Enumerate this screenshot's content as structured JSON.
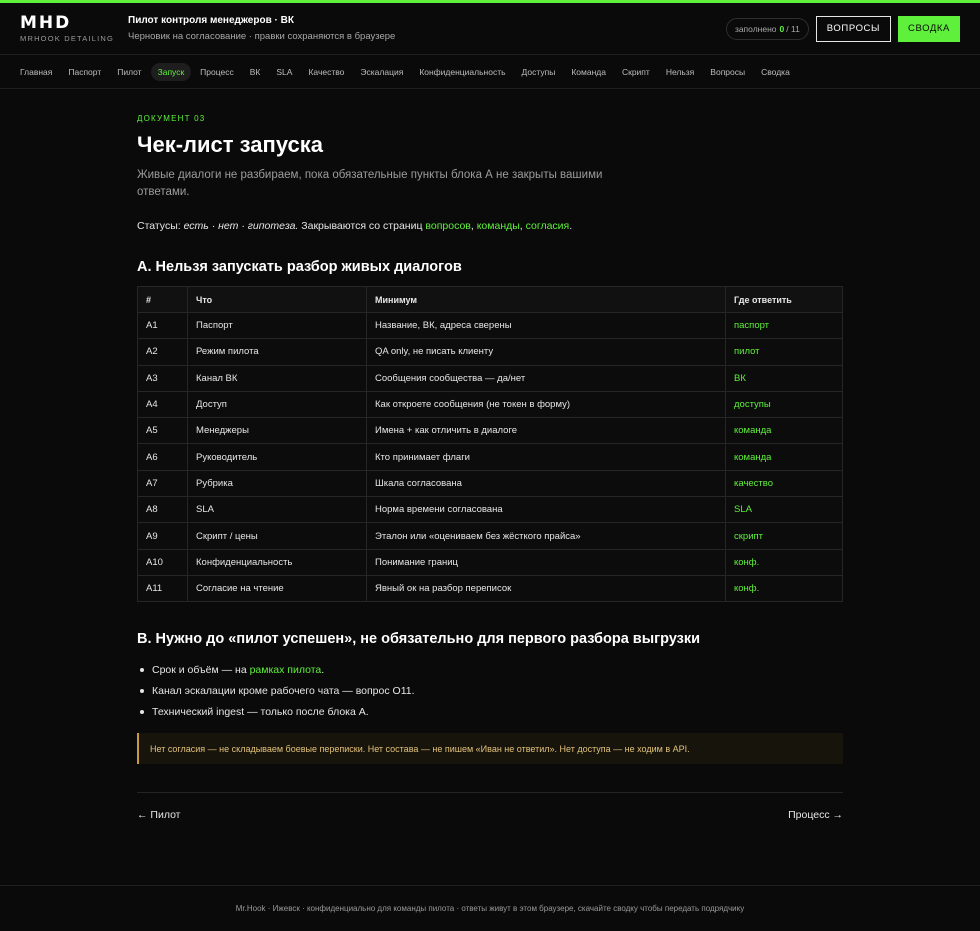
{
  "header": {
    "logo": "MHD",
    "logo_sub": "MRHOOK DETAILING",
    "title": "Пилот контроля менеджеров · ВК",
    "subtitle": "Черновик на согласование · правки сохраняются в браузере",
    "counter_prefix": "заполнено",
    "counter_filled": "0",
    "counter_total": "/ 11",
    "questions_button": "ВОПРОСЫ",
    "summary_button": "СВОДКА"
  },
  "nav": {
    "tabs": [
      "Главная",
      "Паспорт",
      "Пилот",
      "Запуск",
      "Процесс",
      "ВК",
      "SLA",
      "Качество",
      "Эскалация",
      "Конфиденциальность",
      "Доступы",
      "Команда",
      "Скрипт",
      "Нельзя",
      "Вопросы",
      "Сводка"
    ],
    "active": "Запуск"
  },
  "doc": {
    "kicker": "ДОКУМЕНТ 03",
    "title": "Чек-лист запуска",
    "lead": "Живые диалоги не разбираем, пока обязательные пункты блока А не закрыты вашими ответами.",
    "statuses_label": "Статусы:",
    "statuses_values": "есть · нет · гипотеза.",
    "statuses_text": "Закрываются со страниц",
    "statuses_links": [
      "вопросов",
      "команды",
      "согласия"
    ],
    "statuses_end": "."
  },
  "section_a": {
    "title": "А. Нельзя запускать разбор живых диалогов",
    "columns": [
      "#",
      "Что",
      "Минимум",
      "Где ответить"
    ],
    "rows": [
      [
        "A1",
        "Паспорт",
        "Название, ВК, адреса сверены",
        "паспорт"
      ],
      [
        "A2",
        "Режим пилота",
        "QA only, не писать клиенту",
        "пилот"
      ],
      [
        "A3",
        "Канал ВК",
        "Сообщения сообщества — да/нет",
        "ВК"
      ],
      [
        "A4",
        "Доступ",
        "Как откроете сообщения (не токен в форму)",
        "доступы"
      ],
      [
        "A5",
        "Менеджеры",
        "Имена + как отличить в диалоге",
        "команда"
      ],
      [
        "A6",
        "Руководитель",
        "Кто принимает флаги",
        "команда"
      ],
      [
        "A7",
        "Рубрика",
        "Шкала согласована",
        "качество"
      ],
      [
        "A8",
        "SLA",
        "Норма времени согласована",
        "SLA"
      ],
      [
        "A9",
        "Скрипт / цены",
        "Эталон или «оцениваем без жёсткого прайса»",
        "скрипт"
      ],
      [
        "A10",
        "Конфиденциальность",
        "Понимание границ",
        "конф."
      ],
      [
        "A11",
        "Согласие на чтение",
        "Явный ок на разбор переписок",
        "конф."
      ]
    ]
  },
  "section_b": {
    "title": "B. Нужно до «пилот успешен», не обязательно для первого разбора выгрузки",
    "item1_text": "Срок и объём — на",
    "item1_link": "рамках пилота",
    "item1_end": ".",
    "item2": "Канал эскалации кроме рабочего чата — вопрос O11.",
    "item3": "Технический ingest — только после блока А."
  },
  "warning": "Нет согласия — не складываем боевые переписки. Нет состава — не пишем «Иван не ответил». Нет доступа — не ходим в API.",
  "pager": {
    "prev": "← Пилот",
    "next": "Процесс →"
  },
  "footer": "Mr.Hook · Ижевск · конфиденциально для команды пилота · ответы живут в этом браузере, скачайте сводку чтобы передать подрядчику"
}
